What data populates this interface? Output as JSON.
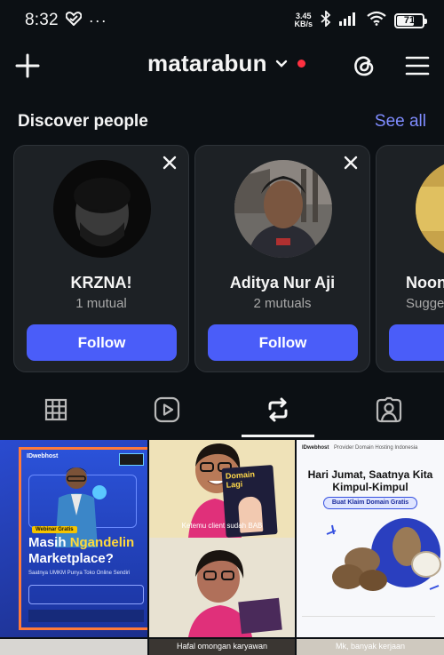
{
  "status_bar": {
    "time": "8:32",
    "net_speed_value": "3.45",
    "net_speed_unit": "KB/s",
    "battery_level": "71",
    "battery_fraction": 0.71
  },
  "header": {
    "username": "matarabun",
    "add_icon": "plus-icon",
    "threads_icon": "threads-icon",
    "menu_icon": "hamburger-menu-icon"
  },
  "discover": {
    "title": "Discover people",
    "see_all": "See all",
    "cards": [
      {
        "name": "KRZNA!",
        "subtitle": "1 mutual",
        "button": "Follow"
      },
      {
        "name": "Aditya Nur Aji",
        "subtitle": "2 mutuals",
        "button": "Follow"
      },
      {
        "name": "Noon",
        "subtitle": "Sugge",
        "button": "F"
      }
    ]
  },
  "tabs": [
    {
      "icon": "grid-icon",
      "selected": false
    },
    {
      "icon": "reels-icon",
      "selected": false
    },
    {
      "icon": "reposts-icon",
      "selected": true
    },
    {
      "icon": "tagged-icon",
      "selected": false
    }
  ],
  "posts": {
    "post1": {
      "brand": "IDwebhost",
      "badge": "Webinar Gratis",
      "headline_1": "Masih",
      "headline_2": "Ngandelin",
      "headline_3": "Marketplace?",
      "subline": "Saatnya UMKM Punya Toko Online Sendiri"
    },
    "post2": {
      "caption_1": "Ketemu client sudah BAB",
      "sign_text": "Domain Lagi",
      "caption_bottom": "Hafal omongan karyawan"
    },
    "post3": {
      "brand": "IDwebhost",
      "tagline": "Provider Domain Hosting Indonesia",
      "headline": "Hari Jumat, Saatnya Kita Kimpul-Kimpul",
      "button": "Buat Klaim Domain Gratis",
      "caption_bottom": "Mk, banyak kerjaan"
    }
  },
  "colors": {
    "background": "#0c1014",
    "card": "#1d2125",
    "accent": "#4a5df9",
    "link": "#7f8cff",
    "notification": "#ff3040"
  }
}
